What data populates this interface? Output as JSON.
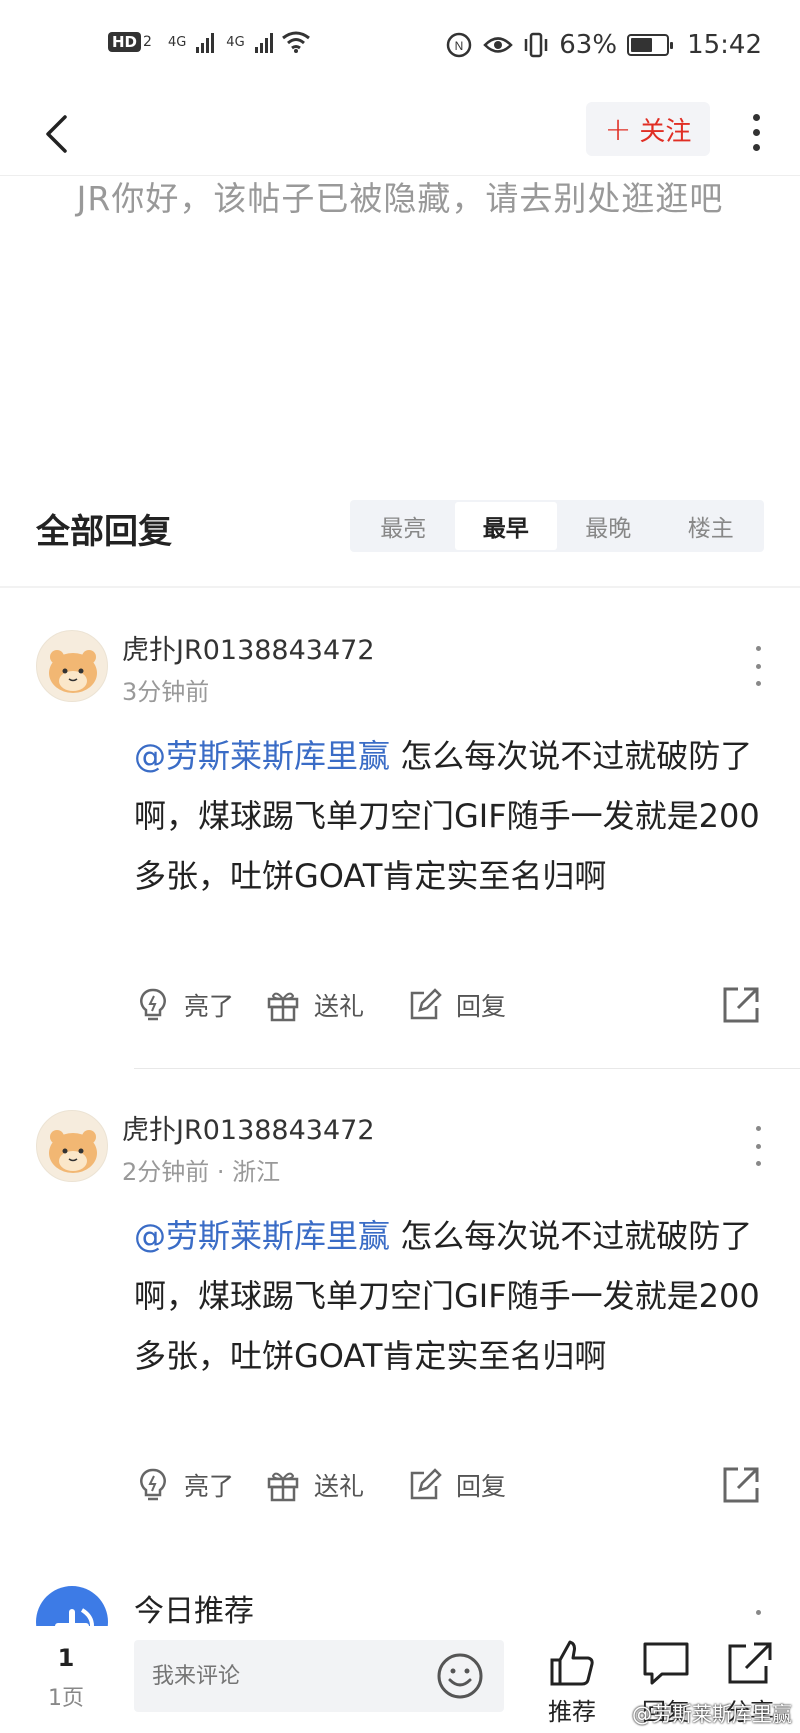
{
  "status_bar": {
    "network_badge": "HD",
    "network_sub": "2",
    "signal_1": "4G",
    "signal_2": "4G",
    "battery": "63%",
    "battery_level": 0.63,
    "time": "15:42"
  },
  "nav": {
    "follow_label": "关注"
  },
  "hidden_notice": "JR你好，该帖子已被隐藏，请去别处逛逛吧",
  "replies": {
    "title": "全部回复",
    "sort_tabs": [
      "最亮",
      "最早",
      "最晚",
      "楼主"
    ],
    "active_tab": "最早"
  },
  "comments": [
    {
      "username": "虎扑JR0138843472",
      "meta": "3分钟前",
      "mention": "@劳斯莱斯库里赢",
      "text": " 怎么每次说不过就破防了啊，煤球踢飞单刀空门GIF随手一发就是200多张，吐饼GOAT肯定实至名归啊",
      "like_label": "亮了",
      "gift_label": "送礼",
      "reply_label": "回复"
    },
    {
      "username": "虎扑JR0138843472",
      "meta": "2分钟前 · 浙江",
      "mention": "@劳斯莱斯库里赢",
      "text": " 怎么每次说不过就破防了啊，煤球踢飞单刀空门GIF随手一发就是200多张，吐饼GOAT肯定实至名归啊",
      "like_label": "亮了",
      "gift_label": "送礼",
      "reply_label": "回复"
    }
  ],
  "recommend": {
    "title": "今日推荐"
  },
  "bottom_bar": {
    "page_number": "1",
    "page_label": "1页",
    "comment_placeholder": "我来评论",
    "recommend_label": "推荐",
    "reply_label": "回复",
    "share_label": "分享"
  },
  "watermark": "@劳斯莱斯库里赢",
  "colors": {
    "accent_red": "#e02e24",
    "mention_blue": "#3a6cc6",
    "recommend_blue": "#3d7be6"
  }
}
